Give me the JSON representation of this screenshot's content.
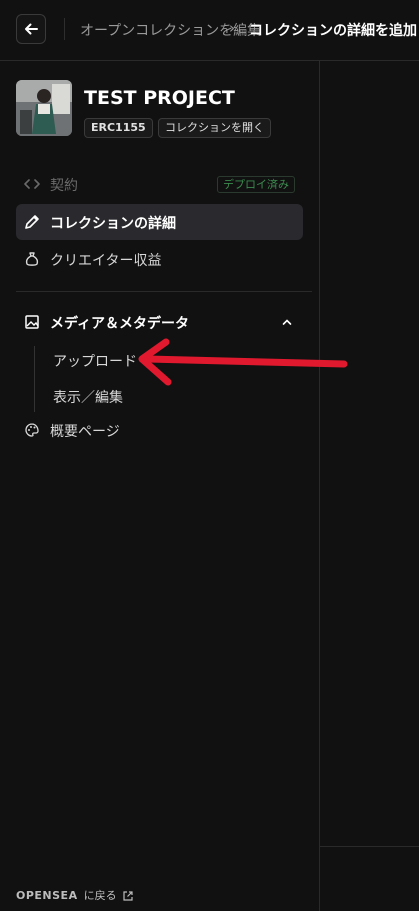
{
  "header": {
    "breadcrumb_parent": "オープンコレクションを編集",
    "breadcrumb_separator": "›",
    "breadcrumb_current": "コレクションの詳細を追加"
  },
  "project": {
    "title": "TEST PROJECT",
    "standard_badge": "ERC1155",
    "open_collection_badge": "コレクションを開く"
  },
  "nav": {
    "contract": {
      "label": "契約",
      "status": "デプロイ済み",
      "icon": "code-icon"
    },
    "details": {
      "label": "コレクションの詳細",
      "icon": "pencil-icon"
    },
    "royalties": {
      "label": "クリエイター収益",
      "icon": "money-bag-icon"
    },
    "media": {
      "label": "メディア＆メタデータ",
      "icon": "image-icon",
      "expanded": true,
      "sub_items": [
        {
          "label": "アップロード"
        },
        {
          "label": "表示／編集"
        }
      ]
    },
    "overview": {
      "label": "概要ページ",
      "icon": "palette-icon"
    }
  },
  "footer": {
    "brand": "OPENSEA",
    "back_label": "に戻る"
  },
  "colors": {
    "background": "#111111",
    "active_item": "#2a2a2e",
    "deploy_green": "#3c8a4f",
    "annotation_arrow": "#e0192e"
  }
}
